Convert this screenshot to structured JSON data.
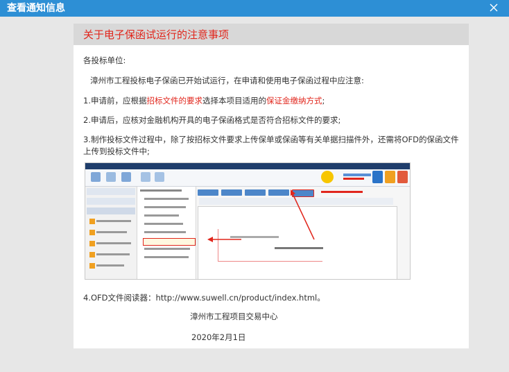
{
  "window": {
    "title": "查看通知信息"
  },
  "notice": {
    "heading": "关于电子保函试运行的注意事项",
    "salutation": "各投标单位:",
    "intro": "漳州市工程投标电子保函已开始试运行，在申请和使用电子保函过程中应注意:",
    "item1": {
      "prefix": "1.申请前，应根据",
      "highlight1": "招标文件的要求",
      "middle": "选择本项目适用的",
      "highlight2": "保证金缴纳方式",
      "suffix": ";"
    },
    "item2": "2.申请后，应核对金融机构开具的电子保函格式是否符合招标文件的要求;",
    "item3": "3.制作投标文件过程中，除了按招标文件要求上传保单或保函等有关单据扫描件外，还需将OFD的保函文件上传到投标文件中;",
    "item4": "4.OFD文件阅读器：http://www.suwell.cn/product/index.html。",
    "issuer": "漳州市工程项目交易中心",
    "date": "2020年2月1日"
  },
  "colors": {
    "titlebar": "#2d8fd5",
    "heading_red": "#e1261c"
  }
}
